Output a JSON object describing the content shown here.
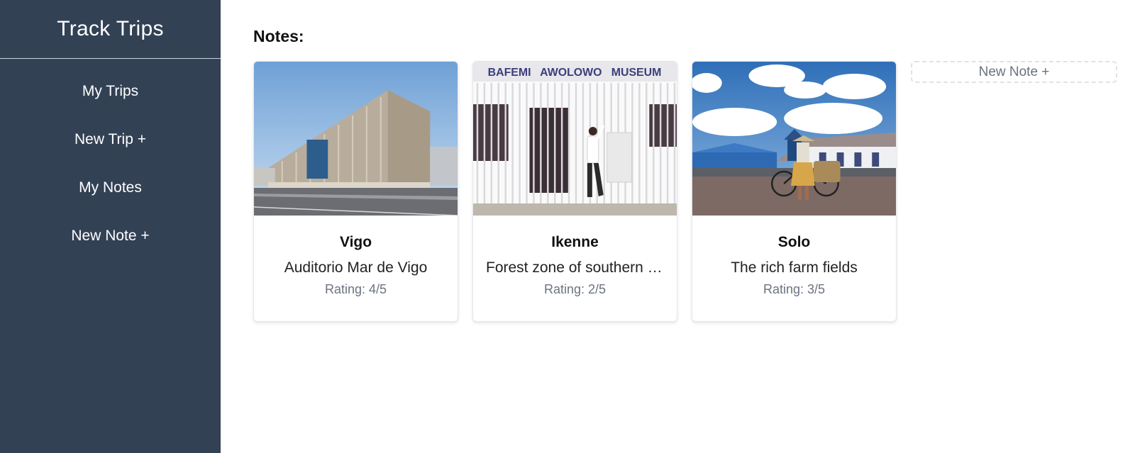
{
  "sidebar": {
    "brand": "Track Trips",
    "items": [
      {
        "label": "My Trips"
      },
      {
        "label": "New Trip +"
      },
      {
        "label": "My Notes"
      },
      {
        "label": "New Note +"
      }
    ]
  },
  "main": {
    "heading": "Notes:",
    "new_note_label": "New Note +",
    "cards": [
      {
        "title": "Vigo",
        "description": "Auditorio Mar de Vigo",
        "rating": "Rating: 4/5",
        "image": "modern-building-photo"
      },
      {
        "title": "Ikenne",
        "description": "Forest zone of southern Nigeria",
        "rating": "Rating: 2/5",
        "image": "museum-gate-photo",
        "sign_text": "BAFEMI   AWOLOWO   MUSEUM"
      },
      {
        "title": "Solo",
        "description": "The rich farm fields",
        "rating": "Rating: 3/5",
        "image": "street-bicycle-photo"
      }
    ]
  }
}
